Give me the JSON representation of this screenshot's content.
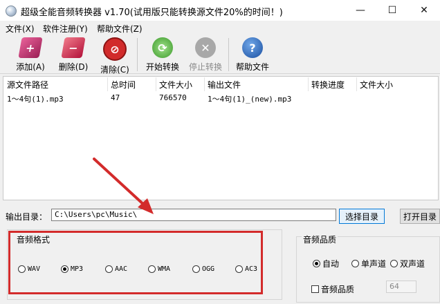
{
  "window": {
    "title": "超级全能音频转换器 v1.70(试用版只能转换源文件20%的时间！)",
    "minimize": "—",
    "maximize": "☐",
    "close": "✕"
  },
  "menu": [
    "文件(X)",
    "软件注册(Y)",
    "帮助文件(Z)"
  ],
  "toolbar": {
    "add": "添加(A)",
    "delete": "删除(D)",
    "clear": "清除(C)",
    "start": "开始转换",
    "stop": "停止转换",
    "help": "帮助文件"
  },
  "list": {
    "columns": [
      "源文件路径",
      "总时间",
      "文件大小",
      "输出文件",
      "转换进度",
      "文件大小"
    ],
    "rows": [
      [
        "1～4句(1).mp3",
        "47",
        "766570",
        "1～4句(1)_(new).mp3",
        "",
        ""
      ]
    ]
  },
  "output": {
    "label": "输出目录：",
    "path": "C:\\Users\\pc\\Music\\",
    "choose_button": "选择目录",
    "open_button": "打开目录"
  },
  "format": {
    "title": "音频格式",
    "options": [
      "WAV",
      "MP3",
      "AAC",
      "WMA",
      "OGG",
      "AC3"
    ],
    "selected": "MP3"
  },
  "quality": {
    "title": "音频品质",
    "options": [
      "自动",
      "单声道",
      "双声道"
    ],
    "selected": "自动",
    "checkbox_label": "音频品质",
    "value": "64"
  },
  "colors": {
    "highlight": "#d32b2b"
  }
}
